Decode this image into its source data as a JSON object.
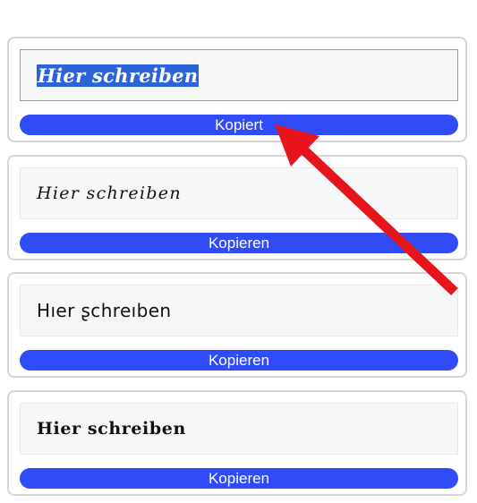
{
  "cards": [
    {
      "text": "𝑯𝒊𝒆𝒓 𝒔𝒄𝒉𝒓𝒆𝒊𝒃𝒆𝒏",
      "button_label": "Kopiert"
    },
    {
      "text": "𝐻𝑖𝑒𝑟 𝑠𝑐ℎ𝑟𝑒𝑖𝑏𝑒𝑛",
      "button_label": "Kopieren"
    },
    {
      "text": "Hıer ʂchreıben",
      "button_label": "Kopieren"
    },
    {
      "text": "𝐇𝐢𝐞𝐫 𝐬𝐜𝐡𝐫𝐞𝐢𝐛𝐞𝐧",
      "button_label": "Kopieren"
    }
  ],
  "colors": {
    "button": "#2f4cf8",
    "selection": "#2b64d8",
    "arrow": "#e8141b",
    "card_border": "#d6d6d6"
  }
}
